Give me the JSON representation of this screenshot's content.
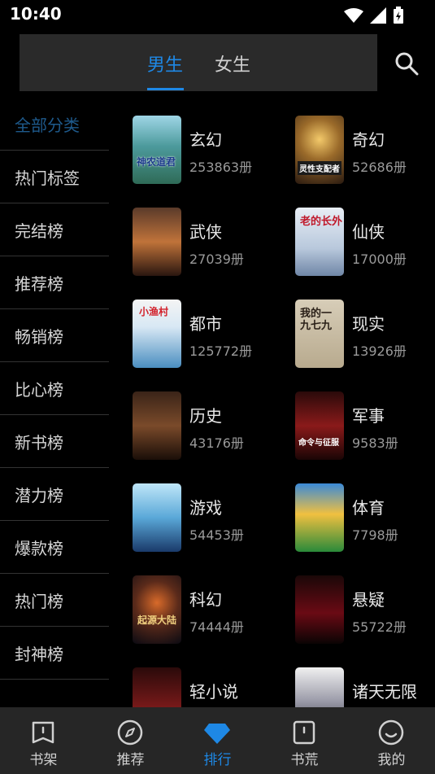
{
  "status": {
    "time": "10:40"
  },
  "tabs": [
    {
      "label": "男生"
    },
    {
      "label": "女生"
    }
  ],
  "sidebar": {
    "items": [
      {
        "label": "全部分类"
      },
      {
        "label": "热门标签"
      },
      {
        "label": "完结榜"
      },
      {
        "label": "推荐榜"
      },
      {
        "label": "畅销榜"
      },
      {
        "label": "比心榜"
      },
      {
        "label": "新书榜"
      },
      {
        "label": "潜力榜"
      },
      {
        "label": "爆款榜"
      },
      {
        "label": "热门榜"
      },
      {
        "label": "封神榜"
      }
    ]
  },
  "categories": [
    {
      "name": "玄幻",
      "count": "253863册"
    },
    {
      "name": "奇幻",
      "count": "52686册"
    },
    {
      "name": "武侠",
      "count": "27039册"
    },
    {
      "name": "仙侠",
      "count": "17000册"
    },
    {
      "name": "都市",
      "count": "125772册"
    },
    {
      "name": "现实",
      "count": "13926册"
    },
    {
      "name": "历史",
      "count": "43176册"
    },
    {
      "name": "军事",
      "count": "9583册"
    },
    {
      "name": "游戏",
      "count": "54453册"
    },
    {
      "name": "体育",
      "count": "7798册"
    },
    {
      "name": "科幻",
      "count": "74444册"
    },
    {
      "name": "悬疑",
      "count": "55722册"
    },
    {
      "name": "轻小说",
      "count": ""
    },
    {
      "name": "诸天无限",
      "count": ""
    }
  ],
  "covers": [
    {
      "title": "神农道君"
    },
    {
      "title": "灵性支配者"
    },
    {
      "title": ""
    },
    {
      "title": "老的长外"
    },
    {
      "title": "小渔村"
    },
    {
      "title": "我的一九七九"
    },
    {
      "title": ""
    },
    {
      "title": "命令与征服"
    },
    {
      "title": ""
    },
    {
      "title": ""
    },
    {
      "title": "起源大陆"
    },
    {
      "title": ""
    },
    {
      "title": ""
    },
    {
      "title": ""
    }
  ],
  "nav": [
    {
      "label": "书架"
    },
    {
      "label": "推荐"
    },
    {
      "label": "排行"
    },
    {
      "label": "书荒"
    },
    {
      "label": "我的"
    }
  ],
  "colors": {
    "accent": "#1e88e5",
    "background": "#000000",
    "nav_bg": "#262626"
  }
}
